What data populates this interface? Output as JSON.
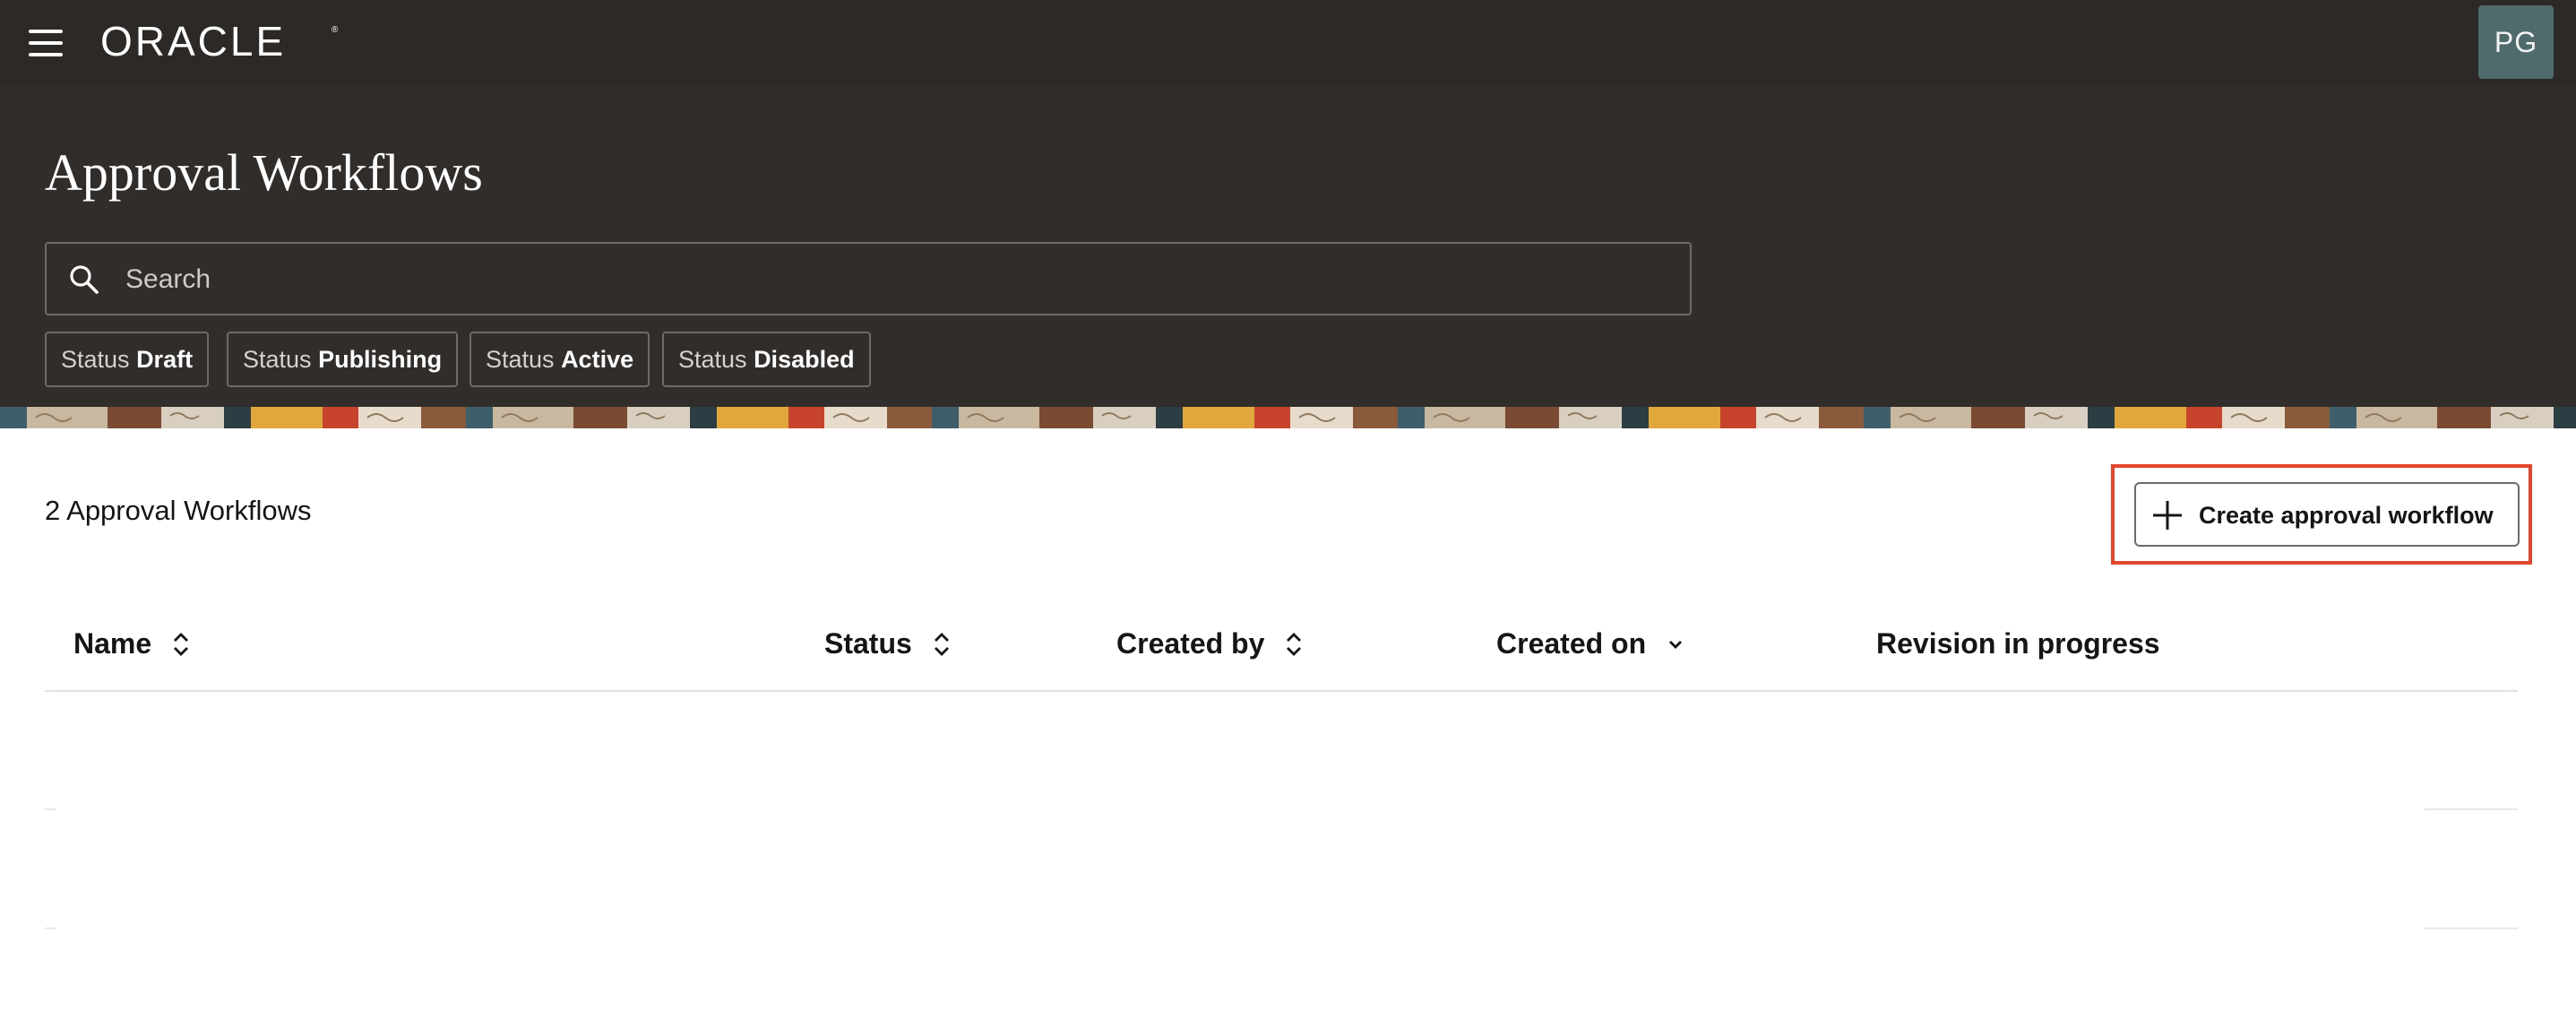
{
  "topbar": {
    "menu_icon": "hamburger-menu-icon",
    "logo_text": "ORACLE",
    "avatar_initials": "PG"
  },
  "header": {
    "title": "Approval Workflows"
  },
  "search": {
    "icon": "search-icon",
    "placeholder": "Search"
  },
  "filters": [
    {
      "prefix": "Status",
      "value": "Draft"
    },
    {
      "prefix": "Status",
      "value": "Publishing"
    },
    {
      "prefix": "Status",
      "value": "Active"
    },
    {
      "prefix": "Status",
      "value": "Disabled"
    }
  ],
  "content": {
    "count_label": "2 Approval Workflows",
    "create_button_label": "Create approval workflow",
    "create_button_icon": "plus-icon",
    "highlight_color": "#e2472d"
  },
  "table": {
    "columns": [
      {
        "label": "Name",
        "sort_icon": "sort-toggle-icon"
      },
      {
        "label": "Status",
        "sort_icon": "sort-toggle-icon"
      },
      {
        "label": "Created by",
        "sort_icon": "sort-toggle-icon"
      },
      {
        "label": "Created on",
        "sort_icon": "sort-descending-icon"
      },
      {
        "label": "Revision in progress"
      }
    ]
  },
  "colors": {
    "header_bg": "#2c2926",
    "hero_bg": "#312d2a",
    "text": "#161513"
  }
}
